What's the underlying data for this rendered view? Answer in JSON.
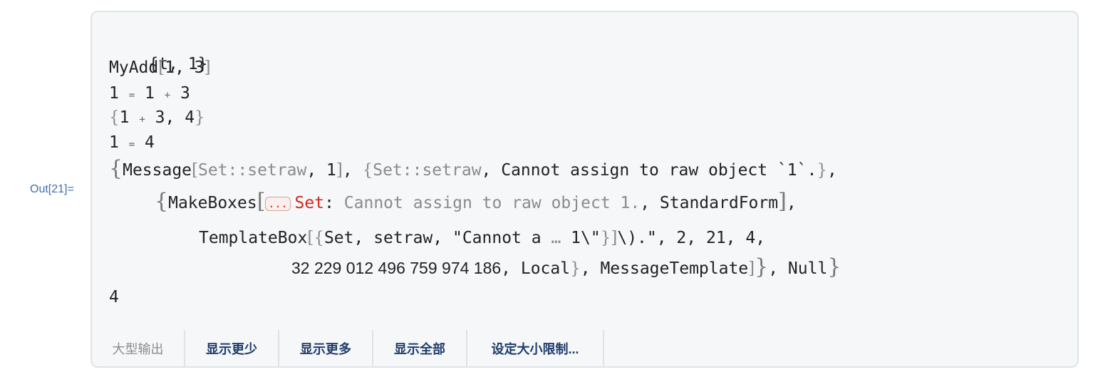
{
  "out_label": "Out[21]=",
  "output": {
    "l1": "{t, 1}",
    "l2_head": "MyAdd",
    "l2_args": "1, 3",
    "l3": [
      "1",
      "=",
      "1",
      "+",
      "3"
    ],
    "l4": [
      "1",
      "+",
      "3, 4"
    ],
    "l5": [
      "1",
      "=",
      "4"
    ],
    "l6": {
      "head": "Message",
      "arg1": "Set::setraw",
      "arg2": ", 1",
      "arg3": "Set::setraw",
      "arg4": ", Cannot assign to raw object `1`."
    },
    "l7": {
      "head": "MakeBoxes",
      "ellipsis": "...",
      "set_word": "Set",
      "colon": ":",
      "msg": "Cannot assign to raw object 1.",
      "tail": ", StandardForm"
    },
    "l8": {
      "head": "TemplateBox",
      "args": "Set, setraw, \"Cannot a",
      "ell": "…",
      "args2": "1\\\"",
      "tail": "\\).\", 2, 21, 4,"
    },
    "l9": {
      "number": "32 229 012 496 759 974 186",
      "local": ", Local",
      "mt": ", MessageTemplate",
      "null": ", Null"
    },
    "l10": "4"
  },
  "toolbar": {
    "title": "大型输出",
    "show_less": "显示更少",
    "show_more": "显示更多",
    "show_all": "显示全部",
    "set_limit": "设定大小限制..."
  }
}
